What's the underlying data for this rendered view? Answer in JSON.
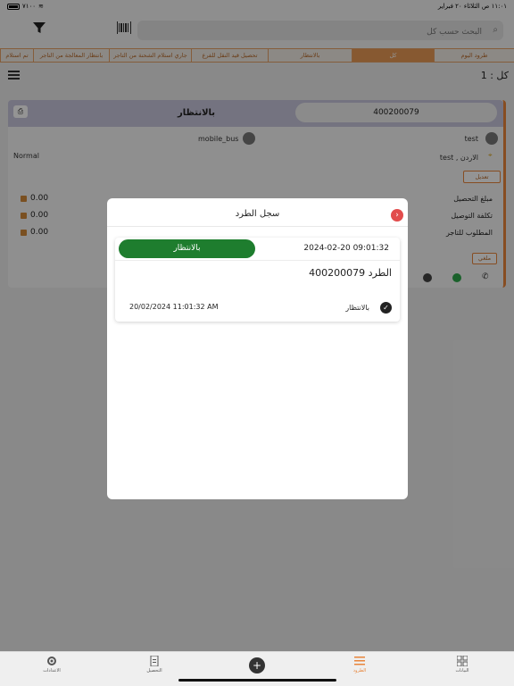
{
  "status_bar": {
    "time_date": "١١:٠١ ص   الثلاثاء ٢٠ فبراير",
    "battery": "٧١٠٠"
  },
  "search": {
    "placeholder": "البحث حسب كل"
  },
  "tabs": [
    {
      "label": "طرود اليوم",
      "active": false
    },
    {
      "label": "كل",
      "active": true
    },
    {
      "label": "بالانتظار",
      "active": false
    },
    {
      "label": "تحصيل قيد النقل للفرع",
      "active": false
    },
    {
      "label": "جاري استلام الشحنة من التاجر",
      "active": false
    },
    {
      "label": "بانتظار المعالجة من التاجر",
      "active": false
    },
    {
      "label": "تم استلام",
      "active": false
    }
  ],
  "count_label": "كل : 1",
  "card": {
    "status": "بالانتظار",
    "parcel_id": "400200079",
    "sender_name": "test",
    "driver_name": "mobile_bus",
    "address": "الاردن , test",
    "priority": "Normal",
    "edit_label": "تعديل",
    "cancel_label": "ملغي",
    "fields": [
      {
        "label": "مبلغ التحصيل",
        "value": "0.00"
      },
      {
        "label": "تكلفة التوصيل",
        "value": "0.00"
      },
      {
        "label": "المطلوب للتاجر",
        "value": "0.00"
      }
    ]
  },
  "modal": {
    "title": "سجل الطرد",
    "status_pill": "بالانتظار",
    "date": "2024-02-20 09:01:32",
    "parcel_label": "الطرد  400200079",
    "entry": {
      "status": "بالانتظار",
      "time": "20/02/2024 11:01:32 AM"
    }
  },
  "bottom_nav": [
    {
      "label": "البيانات",
      "icon": "grid-icon"
    },
    {
      "label": "الطرود",
      "icon": "list-icon",
      "active": true
    },
    {
      "label": "التحصيل",
      "icon": "document-icon"
    },
    {
      "label": "الاعدادات",
      "icon": "gear-icon"
    }
  ],
  "colors": {
    "accent": "#e8853b",
    "green": "#1e7d2e",
    "close": "#e24c4c",
    "header_bar": "#c9c6dc"
  }
}
